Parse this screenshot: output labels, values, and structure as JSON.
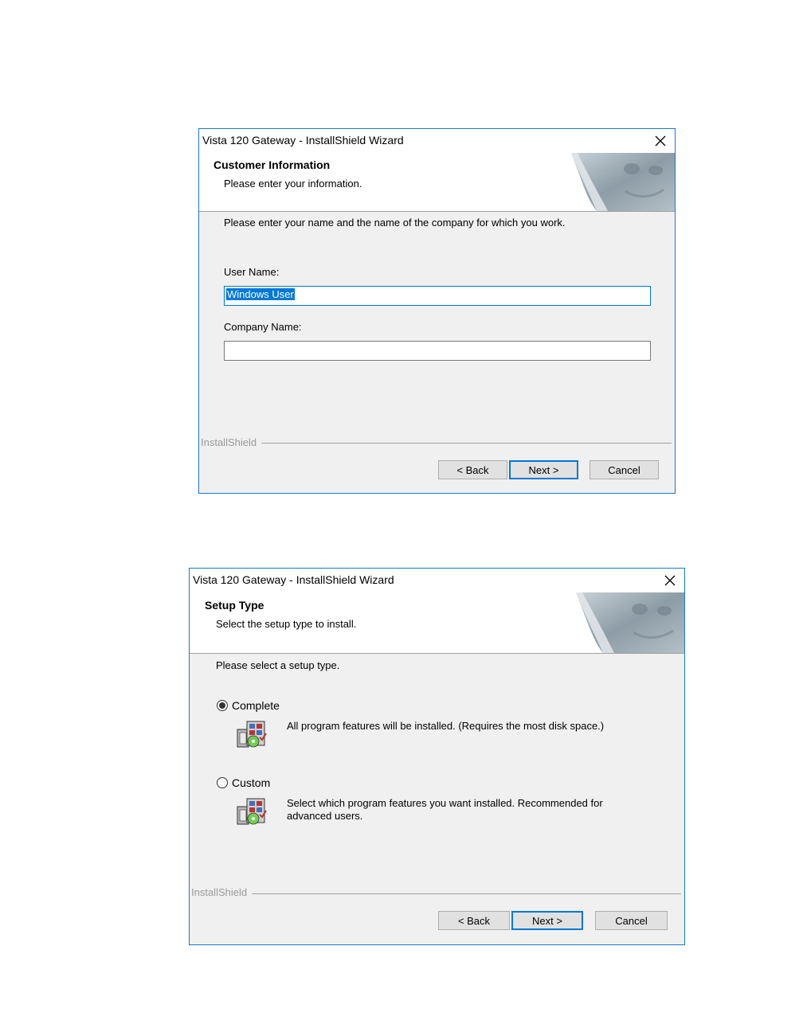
{
  "dialog1": {
    "title": "Vista 120 Gateway - InstallShield Wizard",
    "header_title": "Customer Information",
    "header_subtitle": "Please enter your information.",
    "instruction": "Please enter your name and the name of the company for which you work.",
    "user_name_label": "User Name:",
    "user_name_value": "Windows User",
    "company_name_label": "Company Name:",
    "company_name_value": "",
    "brand": "InstallShield",
    "buttons": {
      "back": "< Back",
      "next": "Next >",
      "cancel": "Cancel"
    }
  },
  "dialog2": {
    "title": "Vista 120 Gateway - InstallShield Wizard",
    "header_title": "Setup Type",
    "header_subtitle": "Select the setup type to install.",
    "instruction": "Please select a setup type.",
    "options": [
      {
        "label": "Complete",
        "selected": true,
        "description": "All program features will be installed. (Requires the most disk space.)"
      },
      {
        "label": "Custom",
        "selected": false,
        "description": "Select which program features you want installed. Recommended for advanced users."
      }
    ],
    "brand": "InstallShield",
    "buttons": {
      "back": "< Back",
      "next": "Next >",
      "cancel": "Cancel"
    }
  },
  "icons": [
    "close-icon",
    "page-curl-art",
    "setup-package-icon"
  ],
  "colors": {
    "accent": "#0078d7",
    "border": "#1979ca",
    "dialog_bg": "#f0f0f0"
  }
}
